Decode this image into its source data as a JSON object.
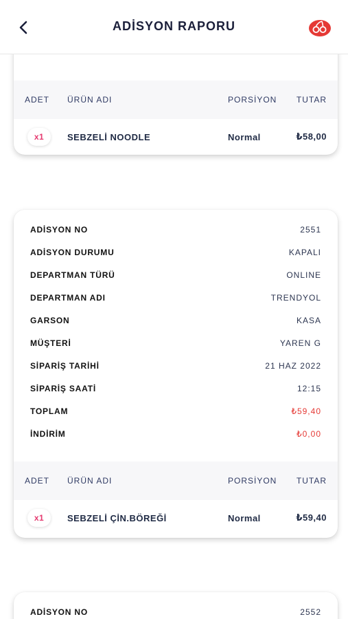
{
  "header": {
    "title": "ADİSYON RAPORU"
  },
  "labels": {
    "adisyon_no": "ADİSYON NO",
    "adisyon_durumu": "ADİSYON DURUMU",
    "departman_turu": "DEPARTMAN TÜRÜ",
    "departman_adi": "DEPARTMAN ADI",
    "garson": "GARSON",
    "musteri": "MÜŞTERİ",
    "siparis_tarihi": "SİPARİŞ TARİHİ",
    "siparis_saati": "SİPARİŞ SAATİ",
    "toplam": "TOPLAM",
    "indirim": "İNDİRİM"
  },
  "columns": {
    "adet": "ADET",
    "urun_adi": "ÜRÜN ADI",
    "porsiyon": "PORSİYON",
    "tutar": "TUTAR"
  },
  "cards": [
    {
      "items": [
        {
          "qty": "x1",
          "name": "SEBZELİ NOODLE",
          "portion": "Normal",
          "price": "₺58,00"
        }
      ]
    },
    {
      "info": {
        "adisyon_no": "2551",
        "adisyon_durumu": "KAPALI",
        "departman_turu": "ONLINE",
        "departman_adi": "TRENDYOL",
        "garson": "KASA",
        "musteri": "YAREN G",
        "siparis_tarihi": "21 HAZ 2022",
        "siparis_saati": "12:15",
        "toplam": "₺59,40",
        "indirim": "₺0,00"
      },
      "items": [
        {
          "qty": "x1",
          "name": "SEBZELİ ÇİN.BÖREĞİ",
          "portion": "Normal",
          "price": "₺59,40"
        }
      ]
    },
    {
      "info": {
        "adisyon_no": "2552"
      }
    }
  ],
  "colors": {
    "accent_red": "#e53935",
    "qty_pink": "#e5396f",
    "header_text": "#2f3a63",
    "brand": "#e53935"
  },
  "icons": {
    "back": "chevron-left-icon",
    "brand": "cherry-logo-icon"
  }
}
